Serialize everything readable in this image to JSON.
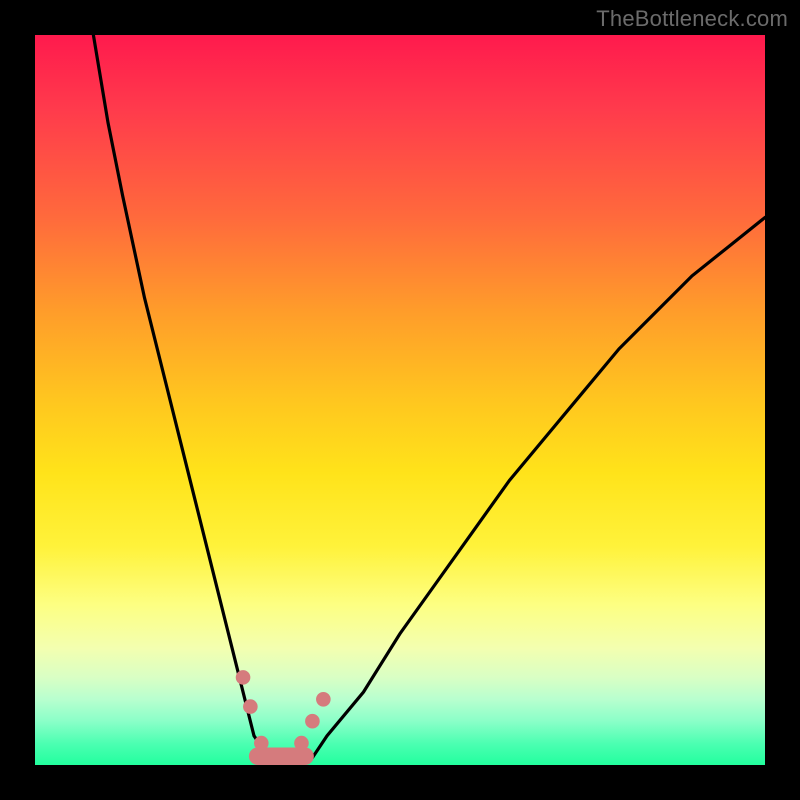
{
  "watermark": "TheBottleneck.com",
  "chart_data": {
    "type": "line",
    "title": "",
    "xlabel": "",
    "ylabel": "",
    "xlim": [
      0,
      100
    ],
    "ylim": [
      0,
      100
    ],
    "grid": false,
    "legend": false,
    "series": [
      {
        "name": "bottleneck-curve",
        "color": "#000000",
        "x": [
          8,
          10,
          12,
          15,
          18,
          20,
          22,
          25,
          27,
          29,
          30,
          32,
          33,
          35,
          38,
          40,
          45,
          50,
          55,
          60,
          65,
          70,
          75,
          80,
          85,
          90,
          95,
          100
        ],
        "y": [
          100,
          88,
          78,
          64,
          52,
          44,
          36,
          24,
          16,
          8,
          4,
          1,
          0,
          0,
          1,
          4,
          10,
          18,
          25,
          32,
          39,
          45,
          51,
          57,
          62,
          67,
          71,
          75
        ]
      }
    ],
    "markers": [
      {
        "name": "p1",
        "x": 28.5,
        "y": 12,
        "r": 1.0,
        "color": "#d57b7d"
      },
      {
        "name": "p2",
        "x": 29.5,
        "y": 8,
        "r": 1.0,
        "color": "#d57b7d"
      },
      {
        "name": "p3",
        "x": 31.0,
        "y": 3,
        "r": 1.0,
        "color": "#d57b7d"
      },
      {
        "name": "p4",
        "x": 36.5,
        "y": 3,
        "r": 1.0,
        "color": "#d57b7d"
      },
      {
        "name": "p5",
        "x": 38.0,
        "y": 6,
        "r": 1.0,
        "color": "#d57b7d"
      },
      {
        "name": "p6",
        "x": 39.5,
        "y": 9,
        "r": 1.0,
        "color": "#d57b7d"
      }
    ],
    "bottom_band": {
      "name": "band",
      "x_start": 30.5,
      "x_end": 37.0,
      "y": 0.0,
      "thickness": 2.4,
      "color": "#d57b7d"
    },
    "background_gradient": {
      "top": "#ff1a4d",
      "mid": "#fff23a",
      "bottom": "#22ff9e"
    }
  }
}
